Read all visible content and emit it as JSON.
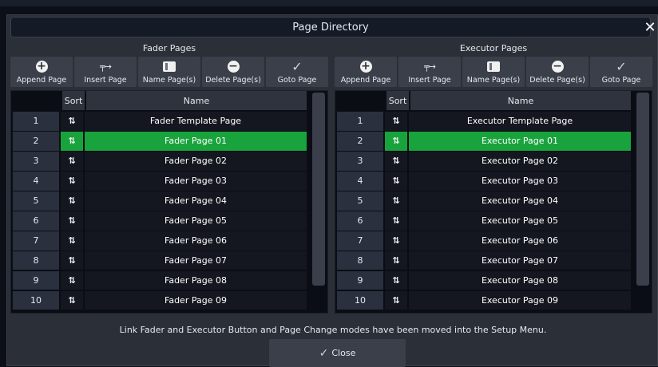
{
  "dialog": {
    "title": "Page Directory",
    "close_icon": "✕",
    "footer_message": "Link Fader and Executor Button and Page Change modes have been moved into the Setup Menu.",
    "close_label": "Close",
    "check_glyph": "✓"
  },
  "colors": {
    "selected_row": "#18a33c",
    "panel_bg": "#2b2f37",
    "table_bg": "#0b0d15"
  },
  "fader": {
    "title": "Fader Pages",
    "toolbar": {
      "append": "Append Page",
      "insert": "Insert Page",
      "name": "Name Page(s)",
      "delete": "Delete Page(s)",
      "goto": "Goto Page"
    },
    "columns": {
      "sort": "Sort",
      "name": "Name"
    },
    "rows": [
      {
        "num": "1",
        "name": "Fader Template Page"
      },
      {
        "num": "2",
        "name": "Fader Page 01"
      },
      {
        "num": "3",
        "name": "Fader Page 02"
      },
      {
        "num": "4",
        "name": "Fader Page 03"
      },
      {
        "num": "5",
        "name": "Fader Page 04"
      },
      {
        "num": "6",
        "name": "Fader Page 05"
      },
      {
        "num": "7",
        "name": "Fader Page 06"
      },
      {
        "num": "8",
        "name": "Fader Page 07"
      },
      {
        "num": "9",
        "name": "Fader Page 08"
      },
      {
        "num": "10",
        "name": "Fader Page 09"
      }
    ]
  },
  "executor": {
    "title": "Executor Pages",
    "toolbar": {
      "append": "Append Page",
      "insert": "Insert Page",
      "name": "Name Page(s)",
      "delete": "Delete Page(s)",
      "goto": "Goto Page"
    },
    "columns": {
      "sort": "Sort",
      "name": "Name"
    },
    "rows": [
      {
        "num": "1",
        "name": "Executor Template Page"
      },
      {
        "num": "2",
        "name": "Executor Page 01"
      },
      {
        "num": "3",
        "name": "Executor Page 02"
      },
      {
        "num": "4",
        "name": "Executor Page 03"
      },
      {
        "num": "5",
        "name": "Executor Page 04"
      },
      {
        "num": "6",
        "name": "Executor Page 05"
      },
      {
        "num": "7",
        "name": "Executor Page 06"
      },
      {
        "num": "8",
        "name": "Executor Page 07"
      },
      {
        "num": "9",
        "name": "Executor Page 08"
      },
      {
        "num": "10",
        "name": "Executor Page 09"
      }
    ]
  },
  "icons": {
    "append": "plus-circle-icon",
    "insert": "insert-arrow-icon",
    "name": "name-card-icon",
    "delete": "minus-circle-icon",
    "goto": "checkmark-icon",
    "sort": "drag-hand-icon"
  }
}
